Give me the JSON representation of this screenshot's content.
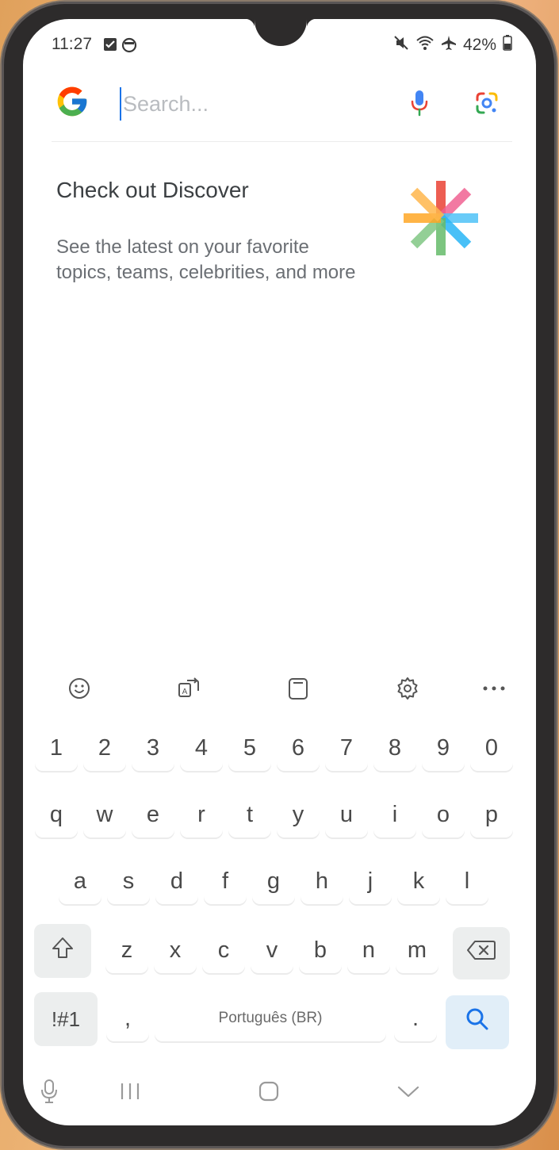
{
  "status_bar": {
    "time": "11:27",
    "battery": "42%",
    "icons": [
      "checkbox-notification-icon",
      "circle-app-icon",
      "mute-icon",
      "wifi-icon",
      "airplane-icon",
      "battery-icon"
    ]
  },
  "search": {
    "placeholder": "Search...",
    "value": ""
  },
  "discover": {
    "title": "Check out Discover",
    "description": "See the latest on your favorite topics, teams, celebrities, and more"
  },
  "keyboard": {
    "toolbar": [
      "emoji-icon",
      "translate-icon",
      "clipboard-icon",
      "settings-icon",
      "more-icon"
    ],
    "rows": {
      "numbers": [
        "1",
        "2",
        "3",
        "4",
        "5",
        "6",
        "7",
        "8",
        "9",
        "0"
      ],
      "row1": [
        "q",
        "w",
        "e",
        "r",
        "t",
        "y",
        "u",
        "i",
        "o",
        "p"
      ],
      "row2": [
        "a",
        "s",
        "d",
        "f",
        "g",
        "h",
        "j",
        "k",
        "l"
      ],
      "row3": [
        "z",
        "x",
        "c",
        "v",
        "b",
        "n",
        "m"
      ]
    },
    "symbols_label": "!#1",
    "comma": ",",
    "space_label": "Português (BR)",
    "period": ".",
    "search_color": "#1a73e8"
  },
  "colors": {
    "google_blue": "#4285F4",
    "google_red": "#EA4335",
    "google_yellow": "#FBBC05",
    "google_green": "#34A853"
  }
}
